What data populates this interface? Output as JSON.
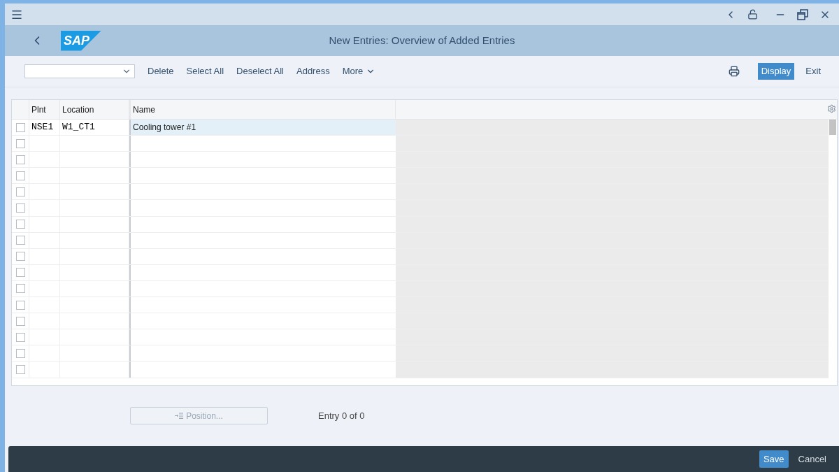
{
  "header": {
    "logo": "SAP",
    "title": "New Entries: Overview of Added Entries"
  },
  "toolbar": {
    "left": [
      "Delete",
      "Select All",
      "Deselect All",
      "Address"
    ],
    "more": "More",
    "right": [
      {
        "label": "Display",
        "emphasized": true
      },
      {
        "label": "Exit",
        "emphasized": false
      }
    ]
  },
  "table": {
    "columns": [
      "Plnt",
      "Location",
      "Name"
    ],
    "rows": [
      {
        "checked": false,
        "selected": true,
        "plnt": "NSE1",
        "location": "W1_CT1",
        "name": "Cooling tower #1"
      },
      {
        "checked": false,
        "selected": false
      },
      {
        "checked": false,
        "selected": false
      },
      {
        "checked": false,
        "selected": false
      },
      {
        "checked": false,
        "selected": false
      },
      {
        "checked": false,
        "selected": false
      },
      {
        "checked": false,
        "selected": false
      },
      {
        "checked": false,
        "selected": false
      },
      {
        "checked": false,
        "selected": false
      },
      {
        "checked": false,
        "selected": false
      },
      {
        "checked": false,
        "selected": false
      },
      {
        "checked": false,
        "selected": false
      },
      {
        "checked": false,
        "selected": false
      },
      {
        "checked": false,
        "selected": false
      },
      {
        "checked": false,
        "selected": false
      },
      {
        "checked": false,
        "selected": false
      }
    ]
  },
  "position_button": {
    "label": "Position...",
    "disabled": true
  },
  "entry_count": "Entry 0 of 0",
  "footer": [
    {
      "label": "Save",
      "emphasized": true
    },
    {
      "label": "Cancel",
      "emphasized": false
    }
  ]
}
